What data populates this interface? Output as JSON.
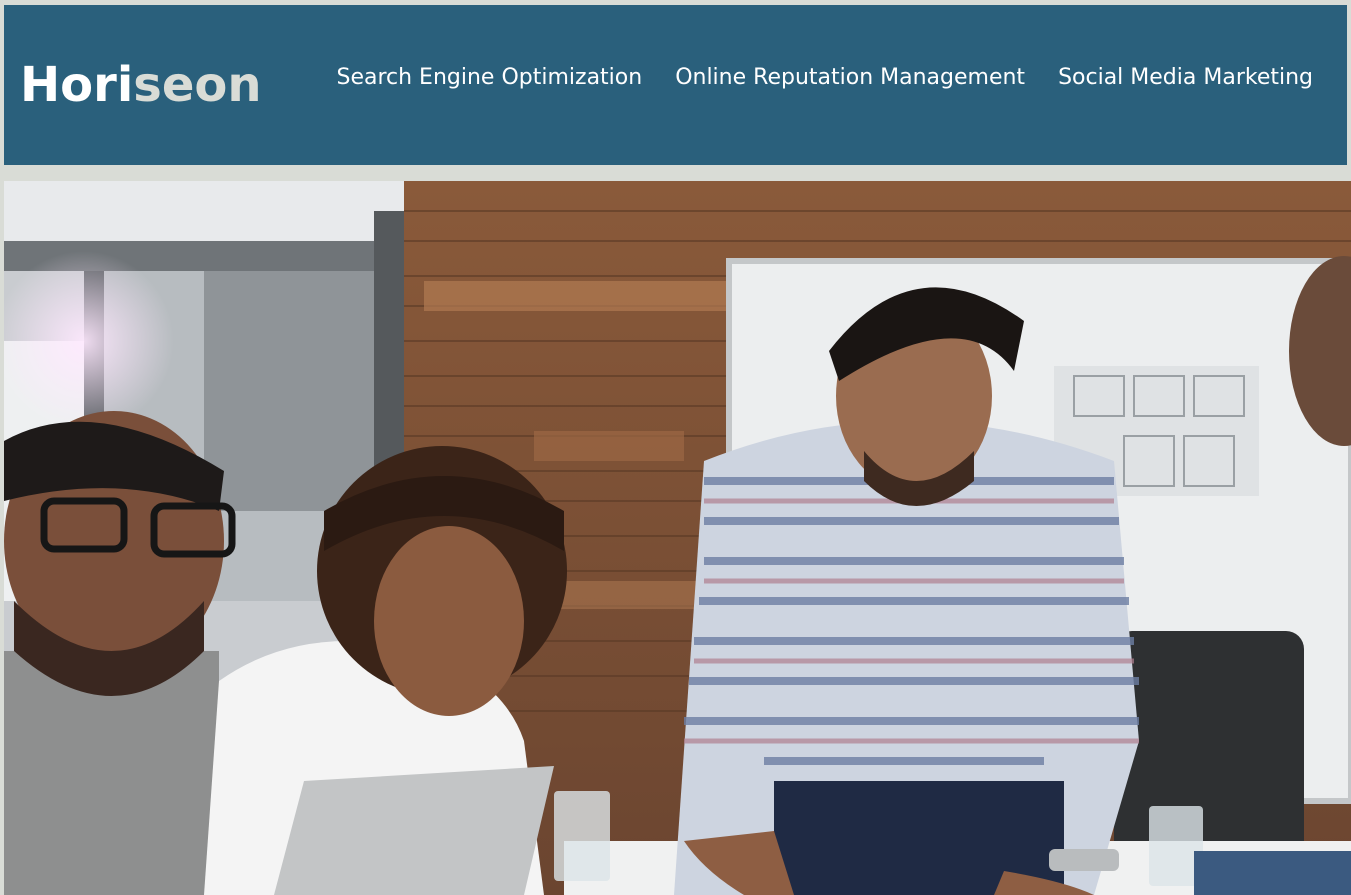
{
  "header": {
    "logo": {
      "prefix": "Hori",
      "suffix": "seon"
    },
    "nav": [
      {
        "label": "Search Engine Optimization"
      },
      {
        "label": "Online Reputation Management"
      },
      {
        "label": "Social Media Marketing"
      }
    ]
  },
  "hero": {
    "image_icon": "team-meeting-photo"
  },
  "colors": {
    "header_bg": "#2a607c",
    "page_bg": "#d9dcd6",
    "logo_accent": "#d9dcd6",
    "nav_text": "#ffffff"
  }
}
